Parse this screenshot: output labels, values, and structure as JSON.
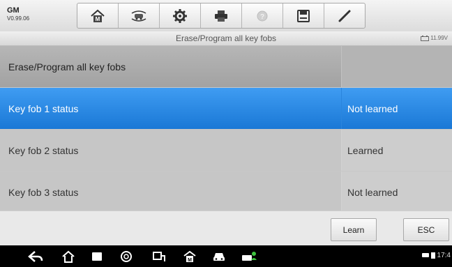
{
  "header": {
    "make": "GM",
    "version": "V0.99.06",
    "tools": [
      {
        "name": "home-icon"
      },
      {
        "name": "vehicle-swap-icon"
      },
      {
        "name": "settings-gear-icon"
      },
      {
        "name": "print-icon"
      },
      {
        "name": "help-icon"
      },
      {
        "name": "save-icon"
      },
      {
        "name": "pen-icon"
      }
    ]
  },
  "subbar": {
    "title": "Erase/Program all key fobs",
    "voltage": "11.99V"
  },
  "table": {
    "rows": [
      {
        "label": "Erase/Program all key fobs",
        "value": ""
      },
      {
        "label": "Key fob 1 status",
        "value": "Not learned"
      },
      {
        "label": "Key fob 2 status",
        "value": "Learned"
      },
      {
        "label": "Key fob 3 status",
        "value": "Not learned"
      }
    ]
  },
  "actions": {
    "learn": "Learn",
    "esc": "ESC"
  },
  "navbar": {
    "time": "17:4"
  },
  "colors": {
    "selected_row": "#2a88e6",
    "row_gray": "#c8c8c8"
  }
}
